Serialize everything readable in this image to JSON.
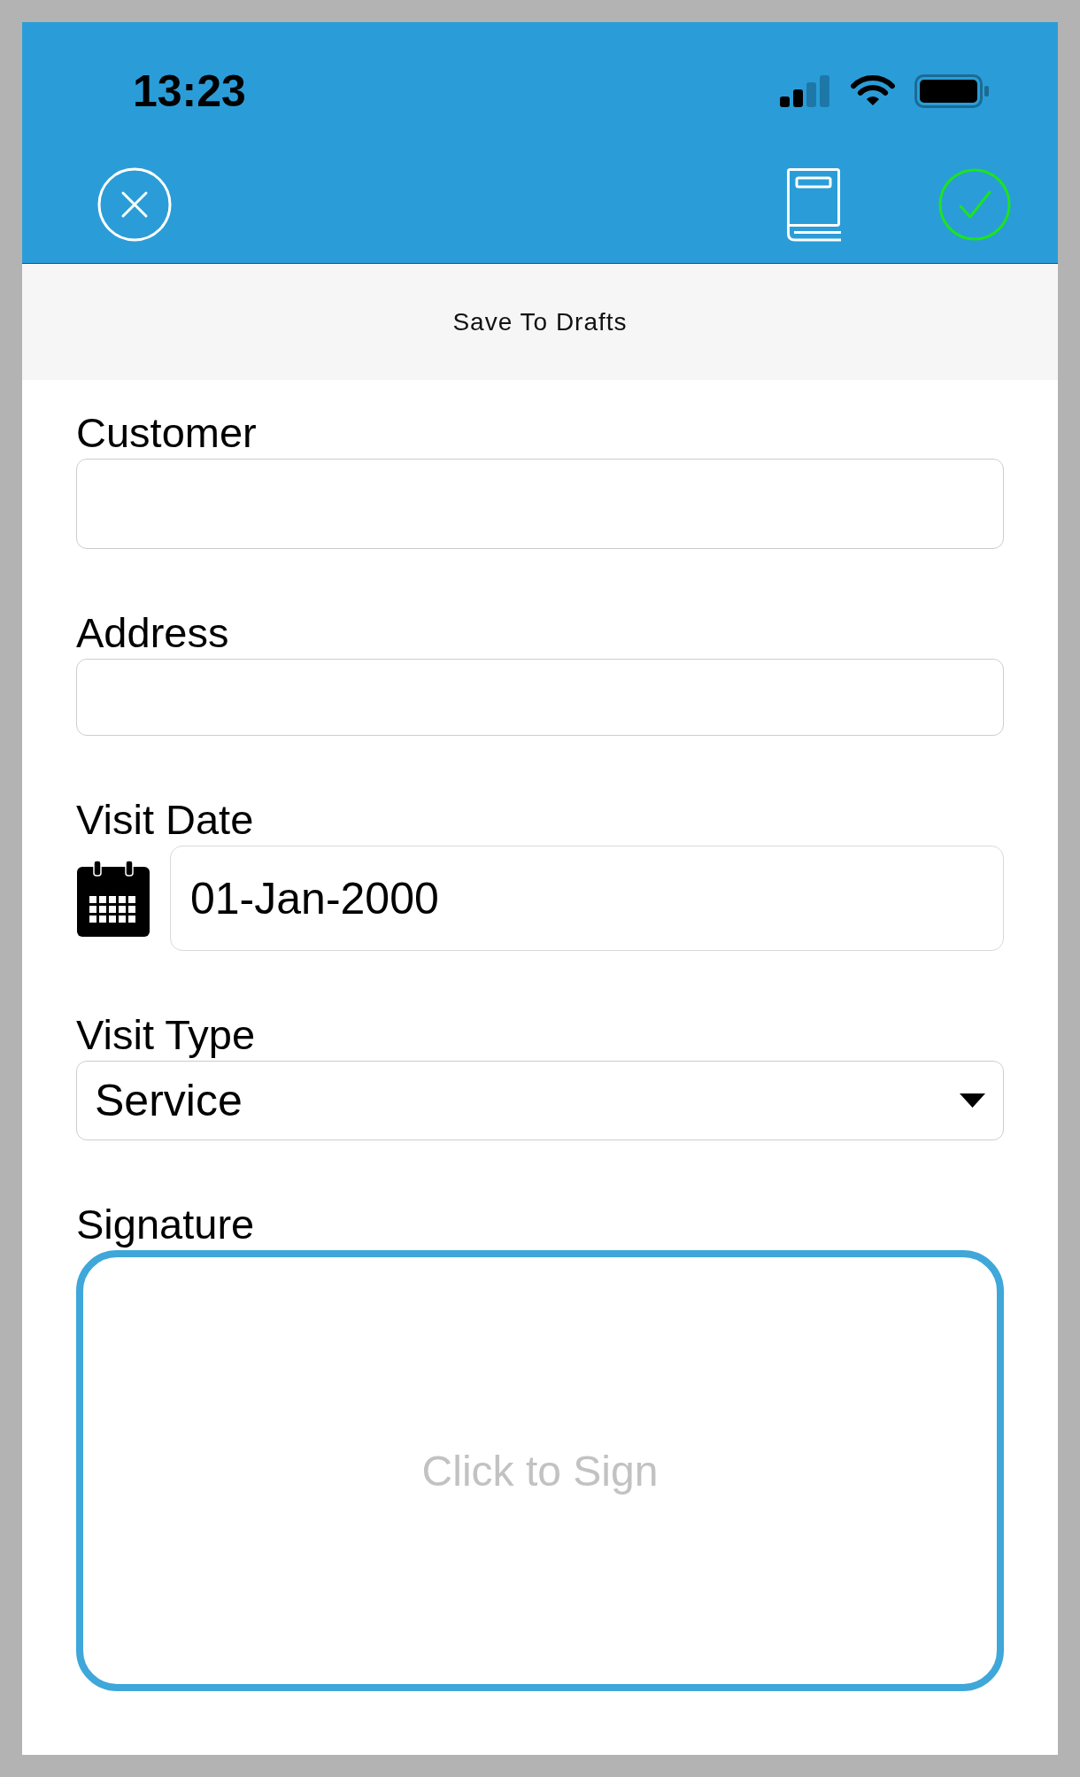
{
  "status_bar": {
    "time": "13:23"
  },
  "toolbar": {
    "drafts_button": "Save To Drafts"
  },
  "form": {
    "fields": [
      {
        "kind": "text",
        "label": "Customer"
      },
      {
        "kind": "text",
        "label": "Address"
      },
      {
        "kind": "date",
        "label": "Visit Date",
        "value": "01-Jan-2000"
      },
      {
        "kind": "select",
        "label": "Visit Type",
        "value": "Service"
      },
      {
        "kind": "signature",
        "label": "Signature",
        "placeholder": "Click to Sign"
      }
    ]
  }
}
